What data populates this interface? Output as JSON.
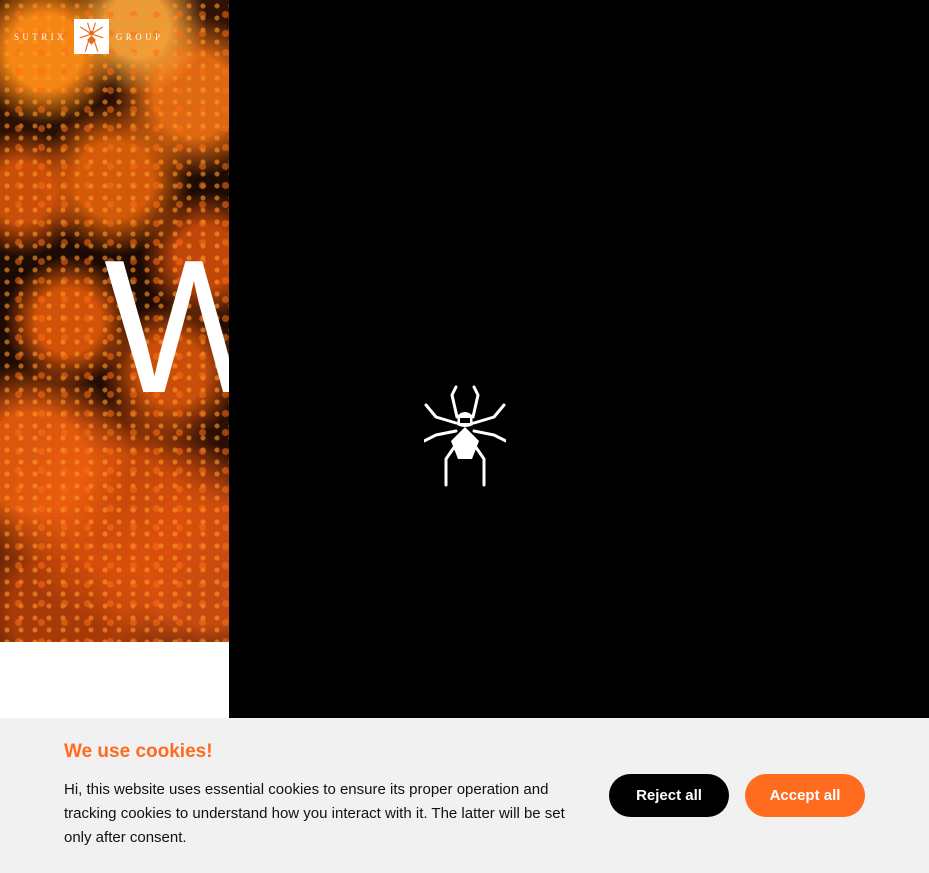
{
  "logo": {
    "left_text": "SUTRIX",
    "right_text": "GROUP"
  },
  "hero": {
    "partial_heading": "W"
  },
  "loader": {
    "icon": "spider-icon"
  },
  "cookie_banner": {
    "title": "We use cookies!",
    "message": "Hi, this website uses essential cookies to ensure its proper operation and tracking cookies to understand how you interact with it. The latter will be set only after consent.",
    "reject_label": "Reject all",
    "accept_label": "Accept all"
  },
  "colors": {
    "accent": "#ff6b1f",
    "overlay": "#000000",
    "banner_bg": "#f1f1f1"
  }
}
